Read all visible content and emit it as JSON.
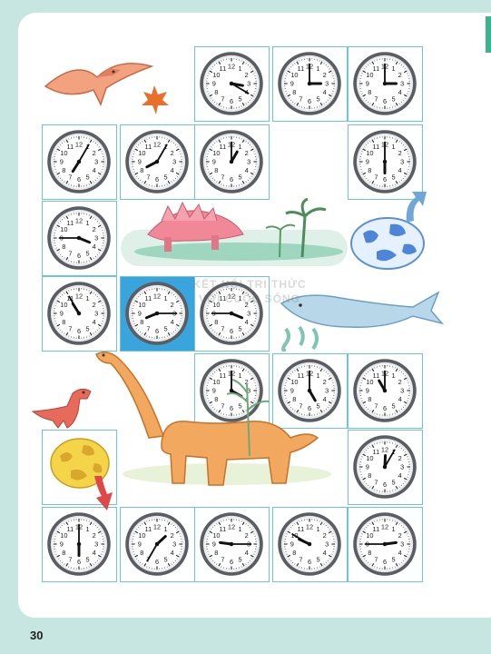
{
  "page_number": "30",
  "watermark": {
    "line1": "KẾT NỐI TRI THỨC",
    "line2": "VỚI CUỘC SỐNG"
  },
  "colors": {
    "page_bg": "#c7e5e1",
    "cell_border": "#6cc6d8",
    "highlight_cell": "#3aa5dc",
    "arrow_blue": "#6fa8d8",
    "arrow_red": "#e04848"
  },
  "path_cells": [
    {
      "clock": {
        "h": 3,
        "m": 20
      }
    },
    {
      "clock": {
        "h": 3,
        "m": 0
      }
    },
    {
      "clock": {
        "h": 3,
        "m": 0
      }
    },
    {
      "clock": {
        "h": 7,
        "m": 5
      }
    },
    {
      "clock": {
        "h": 8,
        "m": 5
      }
    },
    {
      "clock": {
        "h": 1,
        "m": 0
      }
    },
    {
      "clock": {
        "h": 6,
        "m": 0
      }
    },
    {
      "clock": {
        "h": 3,
        "m": 45
      }
    },
    {
      "clock": {
        "h": 10,
        "m": 55
      }
    },
    {
      "clock": {
        "h": 8,
        "m": 15
      },
      "highlight": true
    },
    {
      "clock": {
        "h": 3,
        "m": 45
      }
    },
    {
      "clock": {
        "h": 4,
        "m": 0
      }
    },
    {
      "clock": {
        "h": 5,
        "m": 0
      }
    },
    {
      "clock": {
        "h": 11,
        "m": 0
      }
    },
    {
      "clock": {
        "h": 12,
        "m": 5
      }
    },
    {
      "clock": {
        "h": 6,
        "m": 0
      }
    },
    {
      "clock": {
        "h": 1,
        "m": 35
      }
    },
    {
      "clock": {
        "h": 9,
        "m": 15
      }
    },
    {
      "clock": {
        "h": 9,
        "m": 50
      }
    },
    {
      "clock": {
        "h": 2,
        "m": 45
      }
    },
    {
      "clock": null
    }
  ]
}
